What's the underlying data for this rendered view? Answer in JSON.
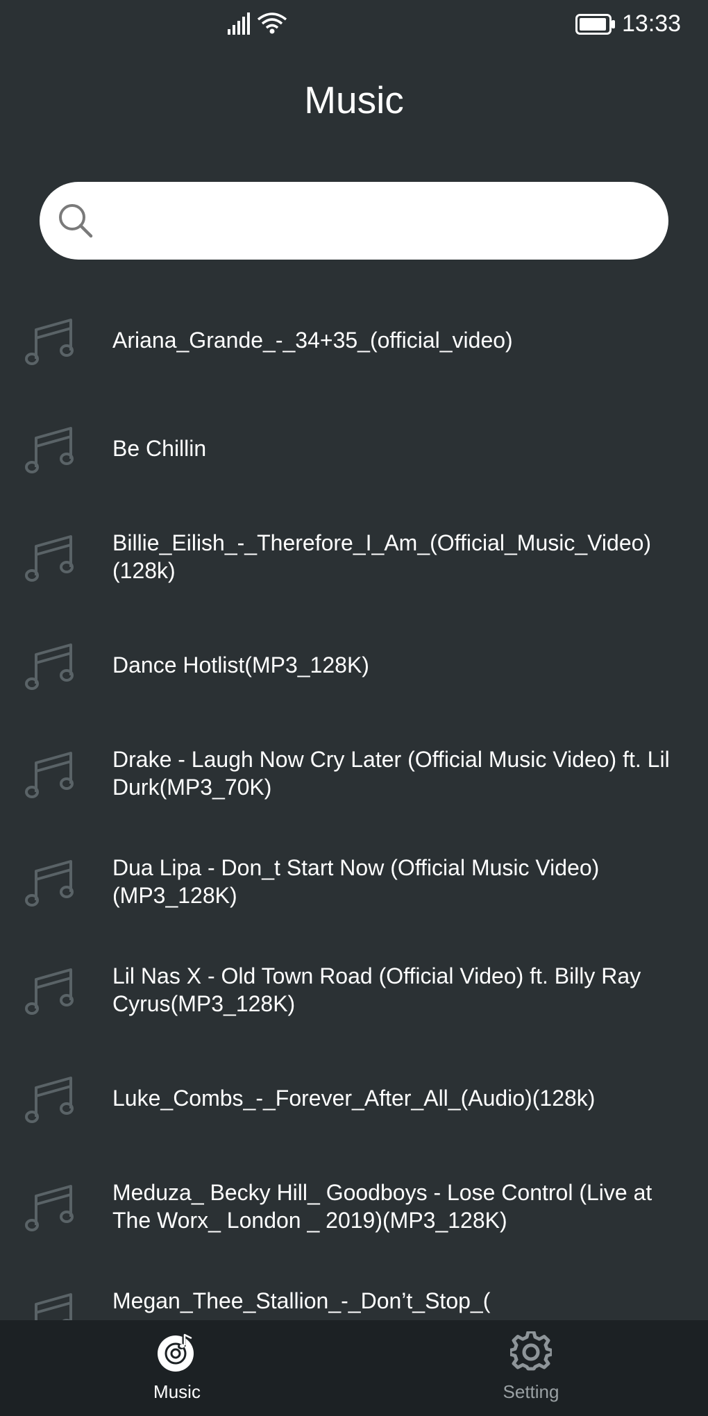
{
  "status_bar": {
    "time": "13:33"
  },
  "header": {
    "title": "Music"
  },
  "search": {
    "placeholder": "",
    "value": ""
  },
  "songs": [
    {
      "title": "Ariana_Grande_-_34+35_(official_video)"
    },
    {
      "title": "Be Chillin"
    },
    {
      "title": "Billie_Eilish_-_Therefore_I_Am_(Official_Music_Video)(128k)"
    },
    {
      "title": "Dance Hotlist(MP3_128K)"
    },
    {
      "title": "Drake - Laugh Now Cry Later (Official Music Video) ft. Lil Durk(MP3_70K)"
    },
    {
      "title": "Dua Lipa - Don_t Start Now (Official Music Video)(MP3_128K)"
    },
    {
      "title": "Lil Nas X - Old Town Road (Official Video) ft. Billy Ray Cyrus(MP3_128K)"
    },
    {
      "title": "Luke_Combs_-_Forever_After_All_(Audio)(128k)"
    },
    {
      "title": "Meduza_ Becky Hill_ Goodboys - Lose Control (Live at The Worx_ London _ 2019)(MP3_128K)"
    },
    {
      "title": "Megan_Thee_Stallion_-_Don’t_Stop_("
    }
  ],
  "bottom_nav": {
    "items": [
      {
        "label": "Music",
        "icon": "music-disc-icon",
        "active": true
      },
      {
        "label": "Setting",
        "icon": "gear-icon",
        "active": false
      }
    ]
  },
  "colors": {
    "background": "#2b3134",
    "nav_background": "#1c2124",
    "icon_muted": "#5a6367",
    "text": "#ffffff",
    "inactive_text": "#9aa1a4"
  }
}
